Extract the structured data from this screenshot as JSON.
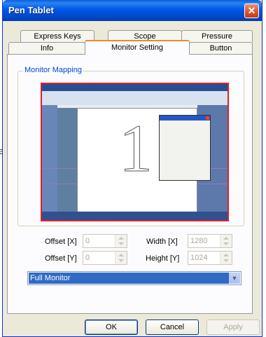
{
  "background_fragment": "e",
  "window": {
    "title": "Pen Tablet",
    "close_glyph": "✕"
  },
  "tabs": {
    "row1": [
      "Express Keys",
      "Scope",
      "Pressure"
    ],
    "row2": [
      "Info",
      "Monitor Setting",
      "Button"
    ],
    "active": "Monitor Setting"
  },
  "monitor_mapping": {
    "group_label": "Monitor Mapping",
    "preview_number": "1"
  },
  "fields": {
    "offset_x": {
      "label": "Offset [X]",
      "value": "0"
    },
    "offset_y": {
      "label": "Offset [Y]",
      "value": "0"
    },
    "width": {
      "label": "Width [X]",
      "value": "1280"
    },
    "height": {
      "label": "Height [Y]",
      "value": "1024"
    }
  },
  "monitor_select": {
    "selected": "Full Monitor",
    "arrow_glyph": "▼"
  },
  "buttons": {
    "ok": "OK",
    "cancel": "Cancel",
    "apply": "Apply"
  },
  "colors": {
    "titlebar": "#0058e6",
    "active_tab_accent": "#e68b2c",
    "group_label": "#0046d5",
    "preview_border": "#e31e24",
    "selection": "#316ac5"
  }
}
